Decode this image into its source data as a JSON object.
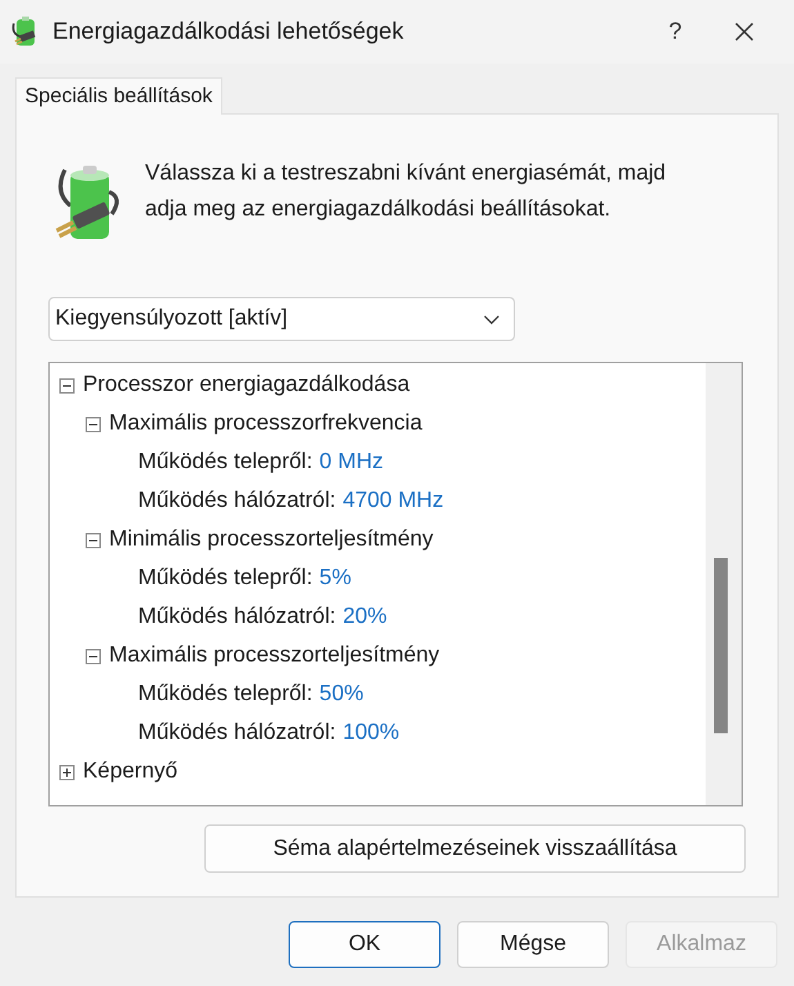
{
  "window": {
    "title": "Energiagazdálkodási lehetőségek",
    "help": "?"
  },
  "tabs": [
    {
      "label": "Speciális beállítások",
      "selected": true
    }
  ],
  "description": "Válassza ki a testreszabni kívánt energiasémát, majd adja meg az energiagazdálkodási beállításokat.",
  "plan_dropdown": {
    "value": "Kiegyensúlyozott [aktív]"
  },
  "tree": [
    {
      "label": "Processzor energiagazdálkodása",
      "expanded": true,
      "children": [
        {
          "label": "Maximális processzorfrekvencia",
          "expanded": true,
          "children": [
            {
              "label": "Működés telepről:",
              "value": "0 MHz"
            },
            {
              "label": "Működés hálózatról:",
              "value": "4700 MHz"
            }
          ]
        },
        {
          "label": "Minimális processzorteljesítmény",
          "expanded": true,
          "children": [
            {
              "label": "Működés telepről:",
              "value": "5%"
            },
            {
              "label": "Működés hálózatról:",
              "value": "20%"
            }
          ]
        },
        {
          "label": "Maximális processzorteljesítmény",
          "expanded": true,
          "children": [
            {
              "label": "Működés telepről:",
              "value": "50%"
            },
            {
              "label": "Működés hálózatról:",
              "value": "100%"
            }
          ]
        }
      ]
    },
    {
      "label": "Képernyő",
      "expanded": false
    }
  ],
  "reset_button": "Séma alapértelmezéseinek visszaállítása",
  "buttons": [
    {
      "label": "OK",
      "kind": "default",
      "disabled": false
    },
    {
      "label": "Mégse",
      "kind": "normal",
      "disabled": false
    },
    {
      "label": "Alkalmaz",
      "kind": "normal",
      "disabled": true
    }
  ]
}
